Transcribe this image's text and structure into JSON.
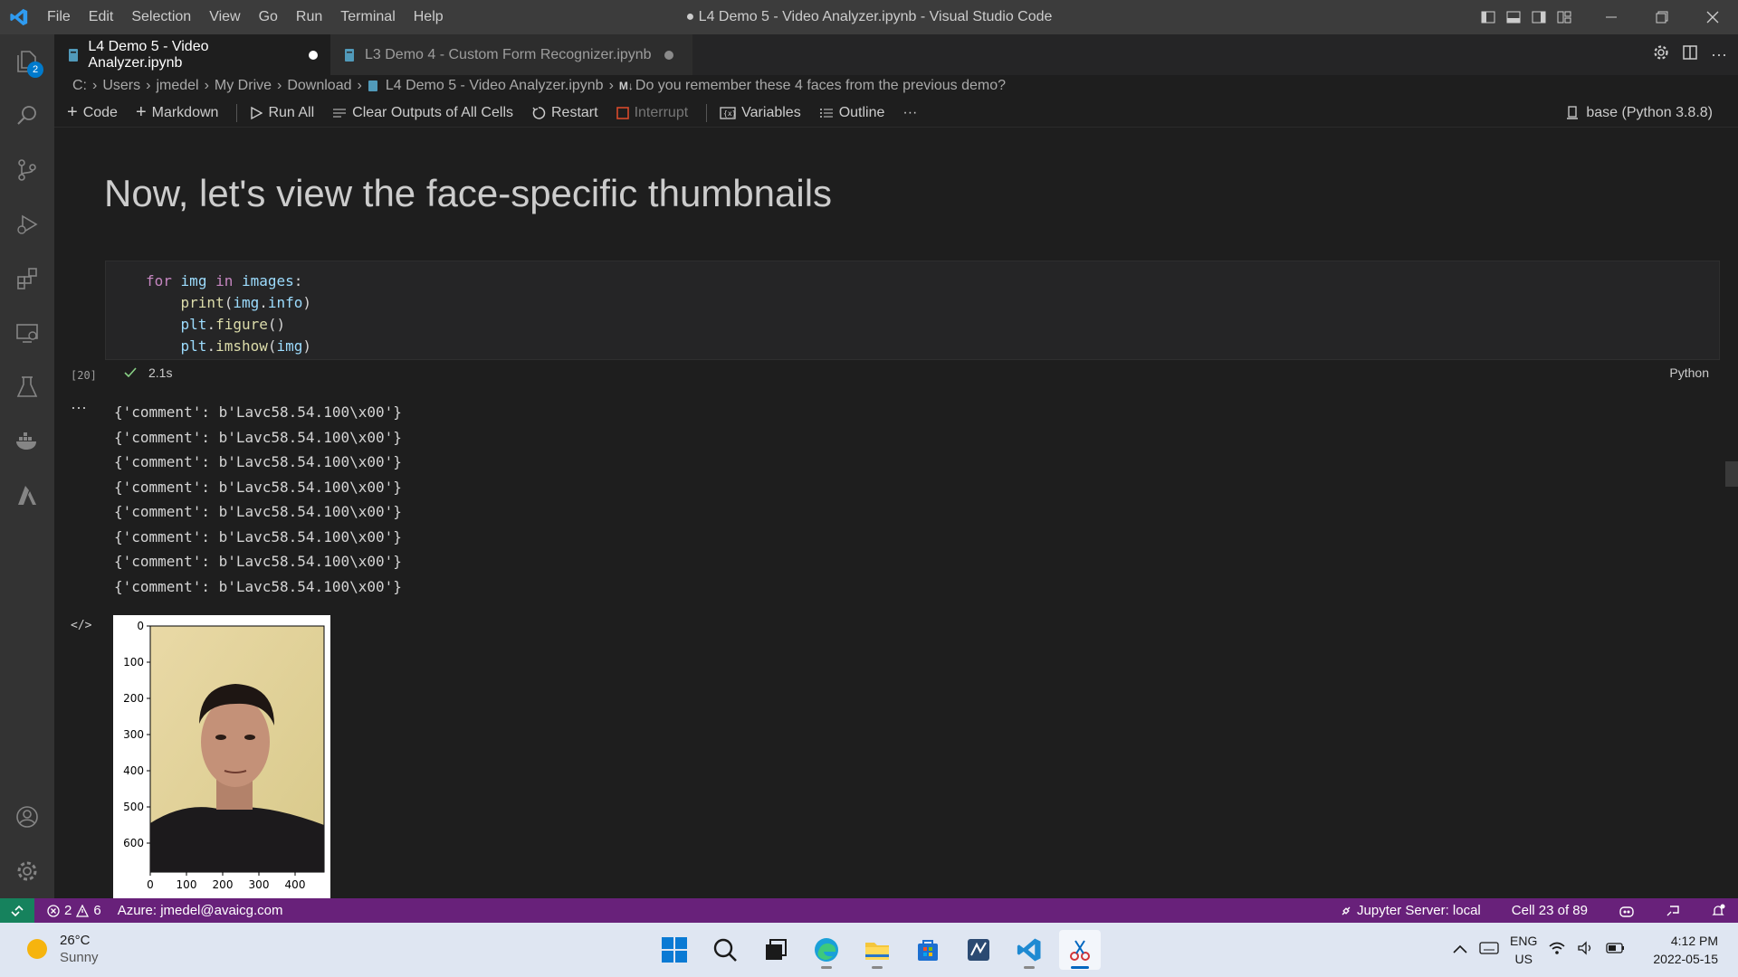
{
  "window": {
    "title": "● L4 Demo 5 - Video Analyzer.ipynb - Visual Studio Code"
  },
  "menu": [
    "File",
    "Edit",
    "Selection",
    "View",
    "Go",
    "Run",
    "Terminal",
    "Help"
  ],
  "activity_bar": {
    "explorer_badge": "2"
  },
  "tabs": [
    {
      "label": "L4 Demo 5 - Video Analyzer.ipynb",
      "dirty": true,
      "active": true
    },
    {
      "label": "L3 Demo 4 - Custom Form Recognizer.ipynb",
      "dirty": true,
      "active": false
    }
  ],
  "breadcrumb": {
    "parts": [
      "C:",
      "Users",
      "jmedel",
      "My Drive",
      "Download",
      "L4 Demo 5 - Video Analyzer.ipynb"
    ],
    "md_prefix": "M↓",
    "last": "Do you remember these 4 faces from the previous demo?"
  },
  "toolbar": {
    "code": "Code",
    "markdown": "Markdown",
    "run_all": "Run All",
    "clear_outputs": "Clear Outputs of All Cells",
    "restart": "Restart",
    "interrupt": "Interrupt",
    "variables": "Variables",
    "outline": "Outline",
    "more": "···",
    "kernel": "base (Python 3.8.8)"
  },
  "notebook": {
    "heading": "Now, let's view the face-specific thumbnails",
    "cell": {
      "execution_count": "[20]",
      "duration": "2.1s",
      "language": "Python"
    },
    "output_marker": "···",
    "output_lines": [
      "{'comment': b'Lavc58.54.100\\x00'}",
      "{'comment': b'Lavc58.54.100\\x00'}",
      "{'comment': b'Lavc58.54.100\\x00'}",
      "{'comment': b'Lavc58.54.100\\x00'}",
      "{'comment': b'Lavc58.54.100\\x00'}",
      "{'comment': b'Lavc58.54.100\\x00'}",
      "{'comment': b'Lavc58.54.100\\x00'}",
      "{'comment': b'Lavc58.54.100\\x00'}"
    ],
    "output_icon": "</>",
    "plot": {
      "y_ticks": [
        "0",
        "100",
        "200",
        "300",
        "400",
        "500",
        "600"
      ],
      "x_ticks": [
        "0",
        "100",
        "200",
        "300",
        "400"
      ]
    }
  },
  "statusbar": {
    "errors": "2",
    "warnings": "6",
    "azure": "Azure: jmedel@avaicg.com",
    "jupyter": "Jupyter Server: local",
    "cell": "Cell 23 of 89"
  },
  "taskbar": {
    "temp": "26°C",
    "condition": "Sunny",
    "lang_top": "ENG",
    "lang_bottom": "US",
    "time": "4:12 PM",
    "date": "2022-05-15"
  },
  "colors": {
    "statusbar": "#68217a",
    "accent": "#007acc"
  }
}
